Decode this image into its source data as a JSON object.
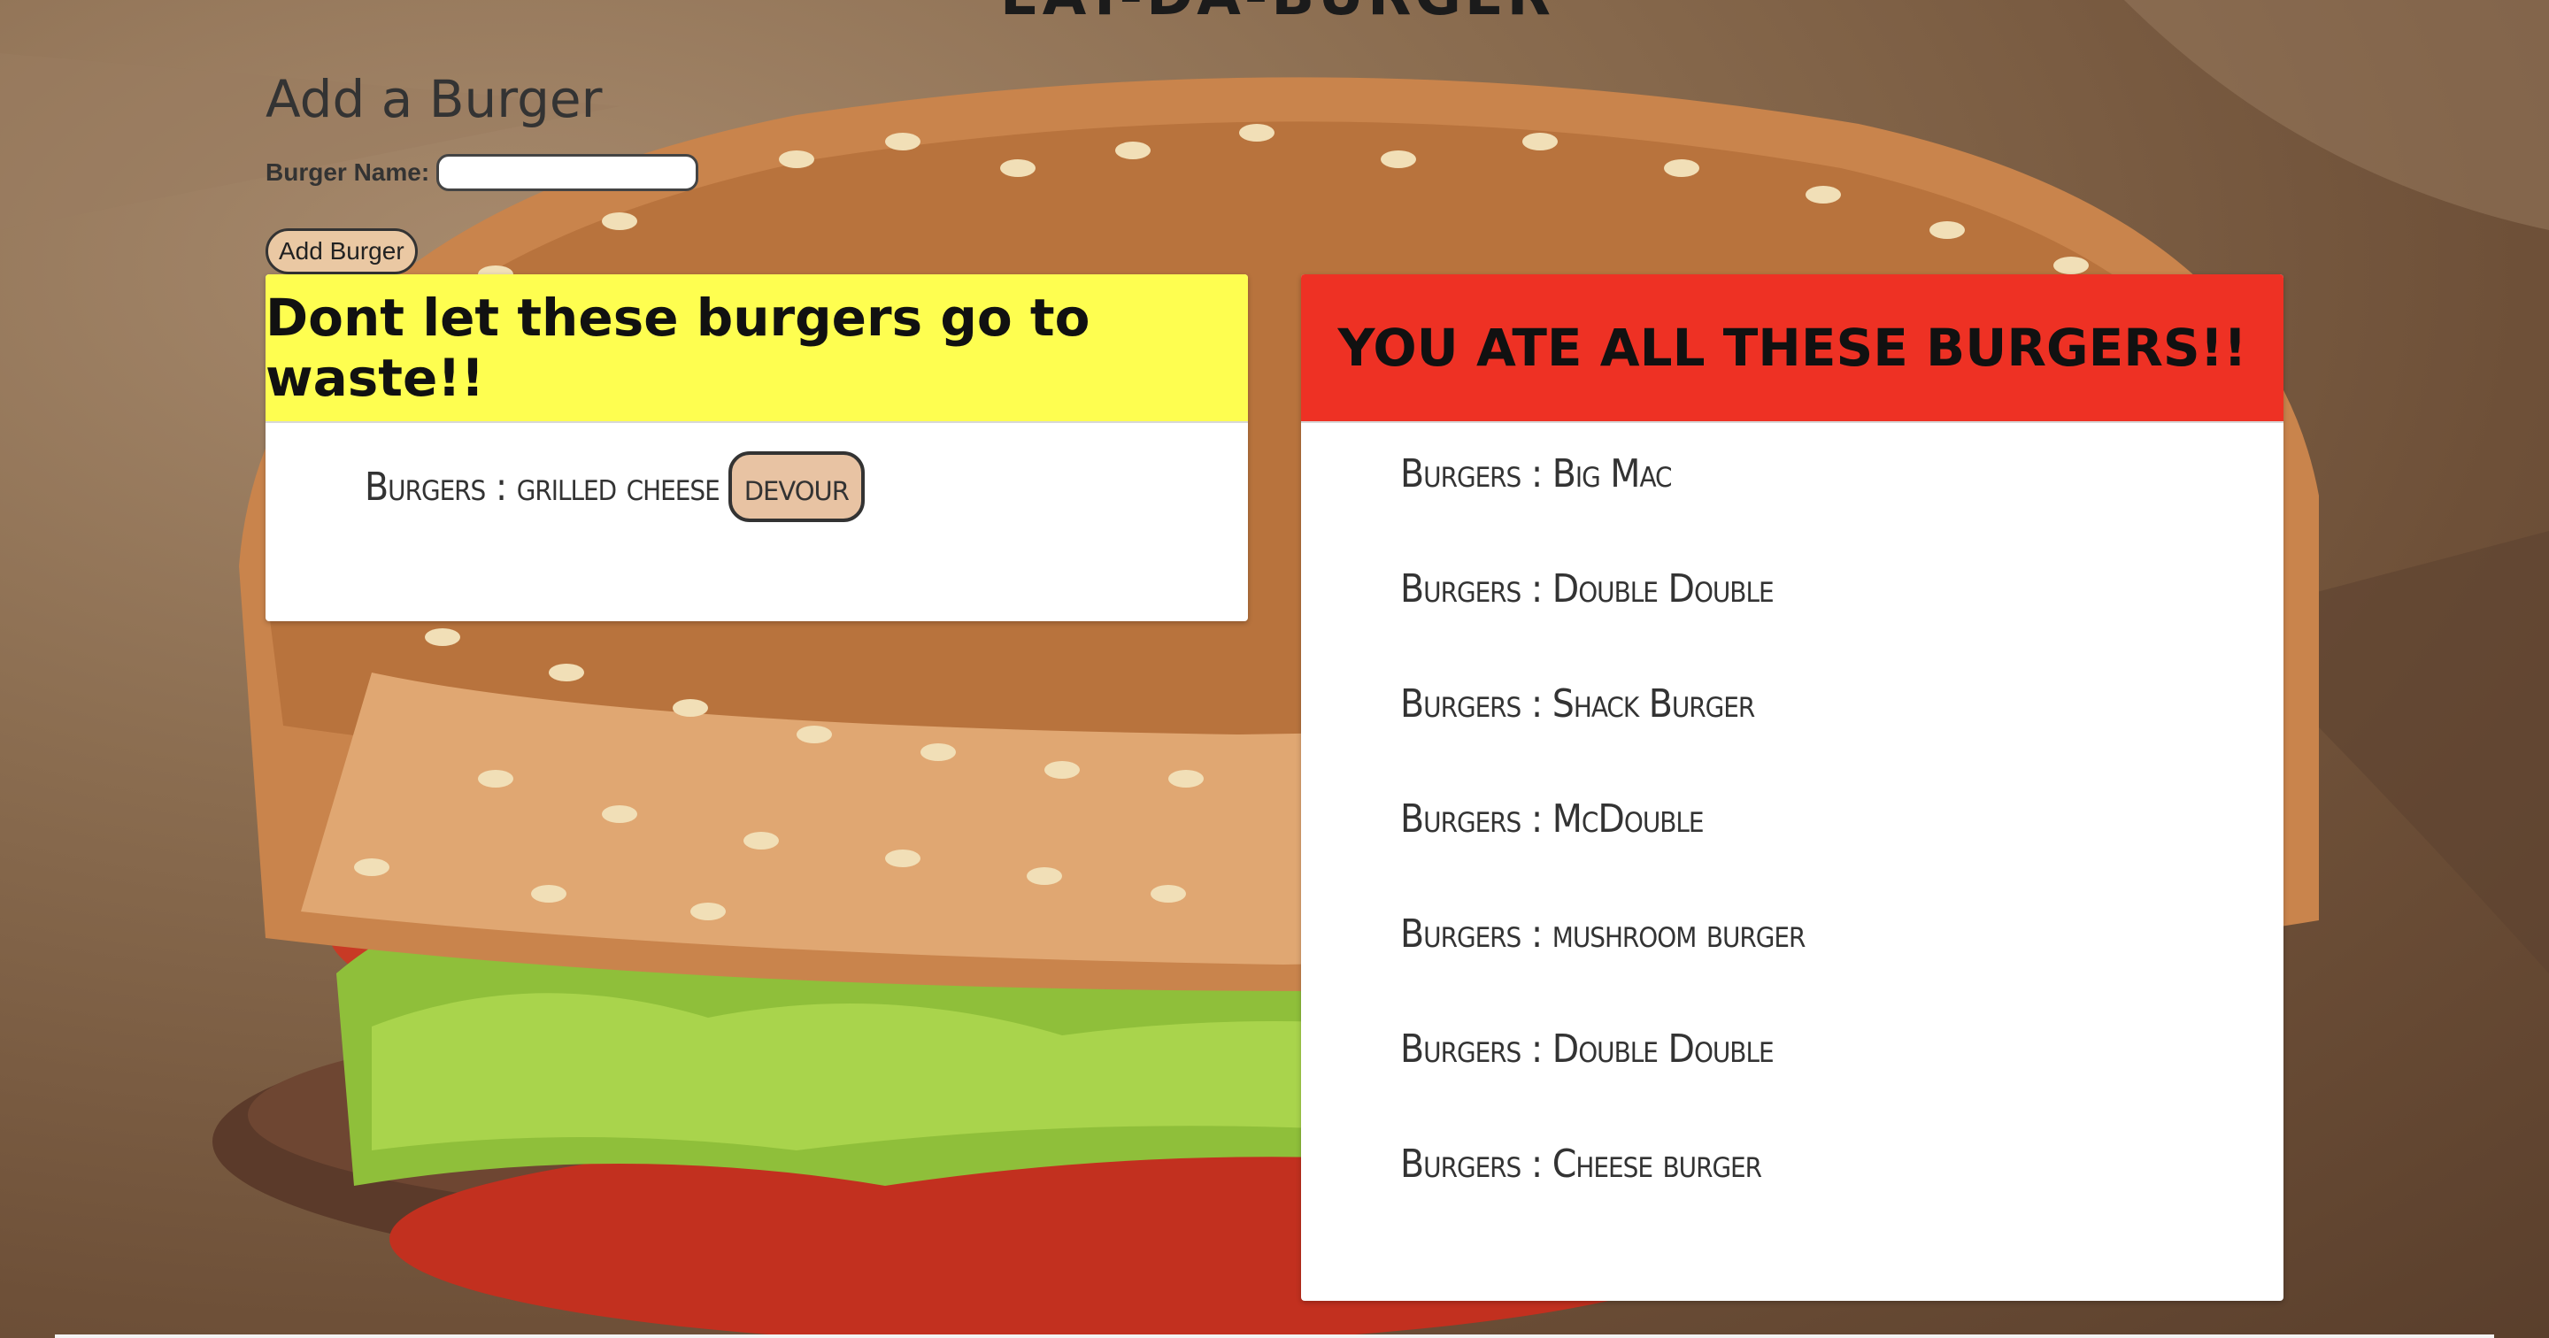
{
  "header": {
    "site_title": "EAT-DA-BURGER"
  },
  "form": {
    "title": "Add a Burger",
    "name_label": "Burger Name:",
    "name_value": "",
    "submit_label": "Add Burger"
  },
  "not_devoured": {
    "heading": "Dont let these burgers go to waste!!",
    "items": [
      {
        "label": "Burgers : grilled cheese",
        "button": "devour"
      }
    ]
  },
  "devoured": {
    "heading": "YOU ATE ALL THESE BURGERS!!",
    "items": [
      {
        "label": "Burgers : Big Mac"
      },
      {
        "label": "Burgers : Double Double"
      },
      {
        "label": "Burgers : Shack Burger"
      },
      {
        "label": "Burgers : McDouble"
      },
      {
        "label": "Burgers : mushroom burger"
      },
      {
        "label": "Burgers : Double Double"
      },
      {
        "label": "Burgers : Cheese burger"
      }
    ]
  },
  "colors": {
    "waste_header": "#fefe50",
    "ate_header": "#ee3124",
    "button_fill": "#e8c3a3"
  }
}
